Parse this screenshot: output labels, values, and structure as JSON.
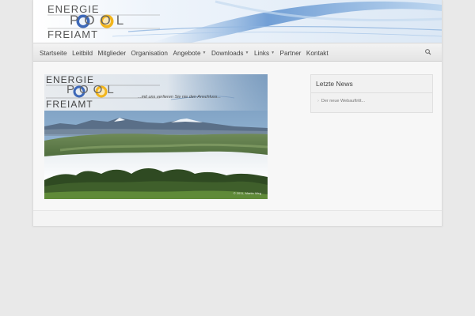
{
  "header": {
    "logo": {
      "line1": "ENERGIE",
      "line2": "POOL",
      "line3": "FREIAMT"
    }
  },
  "nav": {
    "items": [
      {
        "label": "Startseite",
        "dropdown": false
      },
      {
        "label": "Leitbild",
        "dropdown": false
      },
      {
        "label": "Mitglieder",
        "dropdown": false
      },
      {
        "label": "Organisation",
        "dropdown": false
      },
      {
        "label": "Angebote",
        "dropdown": true
      },
      {
        "label": "Downloads",
        "dropdown": true
      },
      {
        "label": "Links",
        "dropdown": true
      },
      {
        "label": "Partner",
        "dropdown": false
      },
      {
        "label": "Kontakt",
        "dropdown": false
      }
    ],
    "search_icon": "search-icon"
  },
  "hero": {
    "logo": {
      "line1": "ENERGIE",
      "line2": "POOL",
      "line3": "FREIAMT"
    },
    "slogan": "...mit uns verlieren Sie nie den Anschluss...",
    "credit": "© 2011, Martin Weg"
  },
  "sidebar": {
    "widget_title": "Letzte News",
    "items": [
      "Der neue Webauftritt..."
    ]
  },
  "colors": {
    "page_bg": "#e9e9e9",
    "header_swoosh": "#4a7fc0",
    "logo_blue": "#3d68b8",
    "logo_yellow": "#f2b51c"
  }
}
